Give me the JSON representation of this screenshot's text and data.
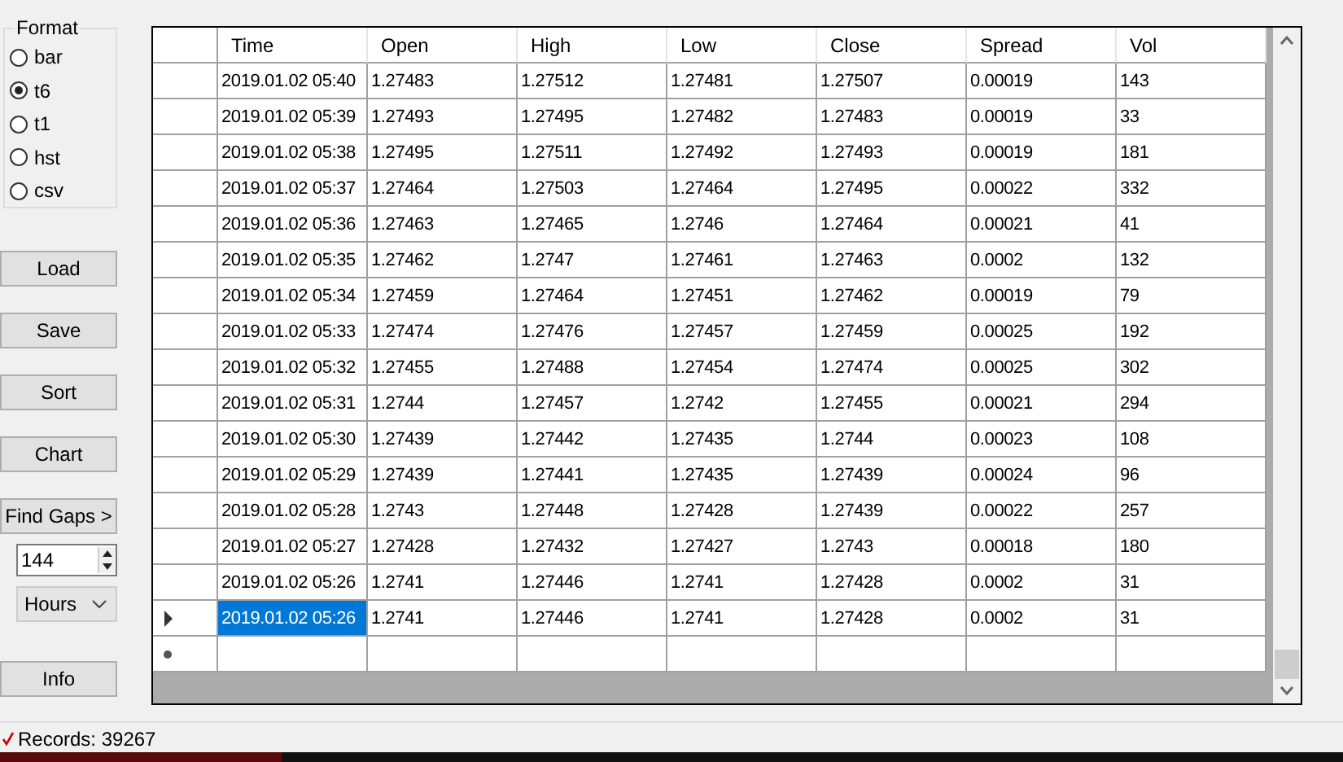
{
  "format_group": {
    "title": "Format",
    "options": [
      {
        "label": "bar",
        "selected": false
      },
      {
        "label": "t6",
        "selected": true
      },
      {
        "label": "t1",
        "selected": false
      },
      {
        "label": "hst",
        "selected": false
      },
      {
        "label": "csv",
        "selected": false
      }
    ]
  },
  "buttons_top": [
    "Load",
    "Save",
    "Sort",
    "Chart",
    "Find Gaps >"
  ],
  "gap_count": {
    "value": "144"
  },
  "gap_unit": {
    "value": "Hours"
  },
  "buttons_bottom": [
    "Info"
  ],
  "table": {
    "columns": [
      "Time",
      "Open",
      "High",
      "Low",
      "Close",
      "Spread",
      "Vol"
    ],
    "rows": [
      {
        "cells": [
          "2019.01.02 05:40",
          "1.27483",
          "1.27512",
          "1.27481",
          "1.27507",
          "0.00019",
          "143"
        ],
        "selected": false
      },
      {
        "cells": [
          "2019.01.02 05:39",
          "1.27493",
          "1.27495",
          "1.27482",
          "1.27483",
          "0.00019",
          "33"
        ],
        "selected": false
      },
      {
        "cells": [
          "2019.01.02 05:38",
          "1.27495",
          "1.27511",
          "1.27492",
          "1.27493",
          "0.00019",
          "181"
        ],
        "selected": false
      },
      {
        "cells": [
          "2019.01.02 05:37",
          "1.27464",
          "1.27503",
          "1.27464",
          "1.27495",
          "0.00022",
          "332"
        ],
        "selected": false
      },
      {
        "cells": [
          "2019.01.02 05:36",
          "1.27463",
          "1.27465",
          "1.2746",
          "1.27464",
          "0.00021",
          "41"
        ],
        "selected": false
      },
      {
        "cells": [
          "2019.01.02 05:35",
          "1.27462",
          "1.2747",
          "1.27461",
          "1.27463",
          "0.0002",
          "132"
        ],
        "selected": false
      },
      {
        "cells": [
          "2019.01.02 05:34",
          "1.27459",
          "1.27464",
          "1.27451",
          "1.27462",
          "0.00019",
          "79"
        ],
        "selected": false
      },
      {
        "cells": [
          "2019.01.02 05:33",
          "1.27474",
          "1.27476",
          "1.27457",
          "1.27459",
          "0.00025",
          "192"
        ],
        "selected": false
      },
      {
        "cells": [
          "2019.01.02 05:32",
          "1.27455",
          "1.27488",
          "1.27454",
          "1.27474",
          "0.00025",
          "302"
        ],
        "selected": false
      },
      {
        "cells": [
          "2019.01.02 05:31",
          "1.2744",
          "1.27457",
          "1.2742",
          "1.27455",
          "0.00021",
          "294"
        ],
        "selected": false
      },
      {
        "cells": [
          "2019.01.02 05:30",
          "1.27439",
          "1.27442",
          "1.27435",
          "1.2744",
          "0.00023",
          "108"
        ],
        "selected": false
      },
      {
        "cells": [
          "2019.01.02 05:29",
          "1.27439",
          "1.27441",
          "1.27435",
          "1.27439",
          "0.00024",
          "96"
        ],
        "selected": false
      },
      {
        "cells": [
          "2019.01.02 05:28",
          "1.2743",
          "1.27448",
          "1.27428",
          "1.27439",
          "0.00022",
          "257"
        ],
        "selected": false
      },
      {
        "cells": [
          "2019.01.02 05:27",
          "1.27428",
          "1.27432",
          "1.27427",
          "1.2743",
          "0.00018",
          "180"
        ],
        "selected": false
      },
      {
        "cells": [
          "2019.01.02 05:26",
          "1.2741",
          "1.27446",
          "1.2741",
          "1.27428",
          "0.0002",
          "31"
        ],
        "selected": false
      },
      {
        "cells": [
          "2019.01.02 05:26",
          "1.2741",
          "1.27446",
          "1.2741",
          "1.27428",
          "0.0002",
          "31"
        ],
        "selected": true
      }
    ]
  },
  "status_bar": {
    "text": "Records: 39267"
  }
}
